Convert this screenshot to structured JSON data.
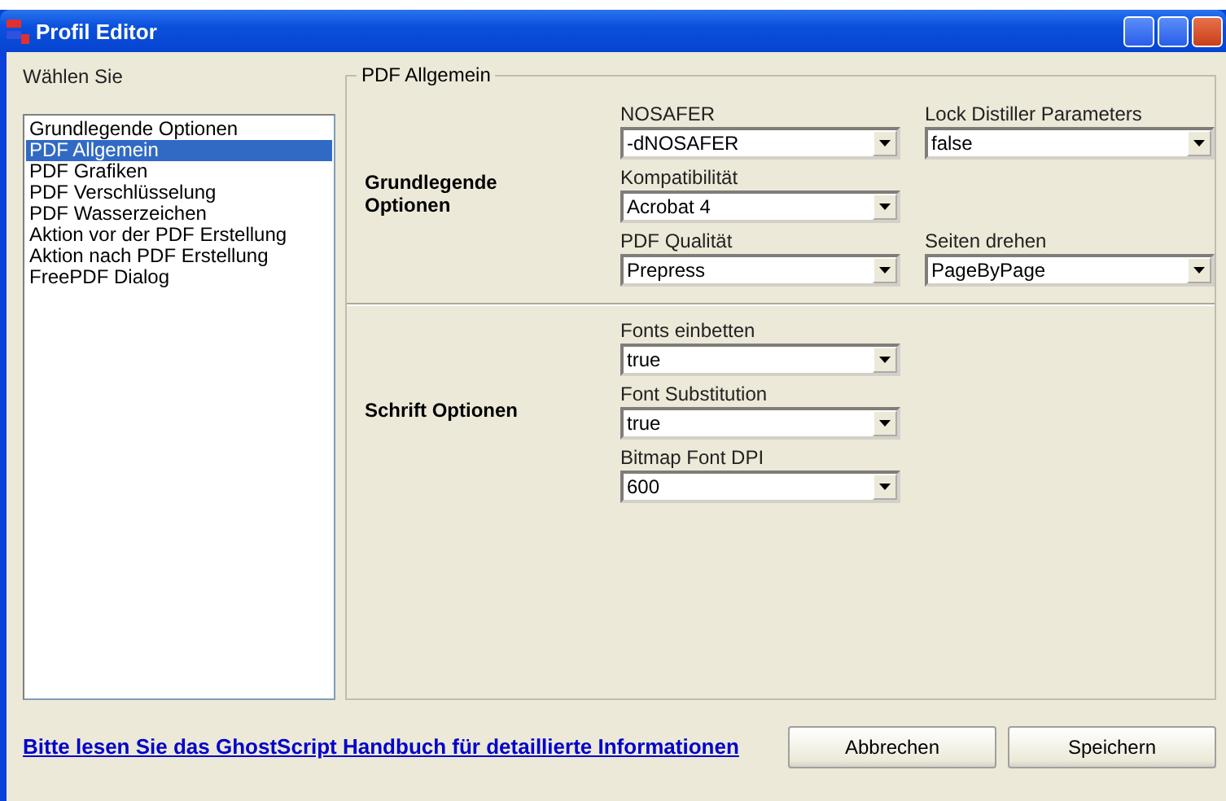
{
  "window": {
    "title": "Profil Editor"
  },
  "sidebar": {
    "label": "Wählen Sie",
    "items": [
      {
        "label": "Grundlegende Optionen",
        "selected": false
      },
      {
        "label": "PDF Allgemein",
        "selected": true
      },
      {
        "label": "PDF Grafiken",
        "selected": false
      },
      {
        "label": "PDF Verschlüsselung",
        "selected": false
      },
      {
        "label": "PDF Wasserzeichen",
        "selected": false
      },
      {
        "label": "Aktion vor der PDF Erstellung",
        "selected": false
      },
      {
        "label": "Aktion nach PDF Erstellung",
        "selected": false
      },
      {
        "label": "FreePDF Dialog",
        "selected": false
      }
    ]
  },
  "group": {
    "title": "PDF Allgemein",
    "sections": [
      {
        "title": "Grundlegende Optionen",
        "rows": [
          [
            {
              "label": "NOSAFER",
              "value": "-dNOSAFER"
            },
            {
              "label": "Lock Distiller Parameters",
              "value": "false"
            }
          ],
          [
            {
              "label": "Kompatibilität",
              "value": "Acrobat 4"
            }
          ],
          [
            {
              "label": "PDF Qualität",
              "value": "Prepress"
            },
            {
              "label": "Seiten drehen",
              "value": "PageByPage"
            }
          ]
        ]
      },
      {
        "title": "Schrift Optionen",
        "rows": [
          [
            {
              "label": "Fonts einbetten",
              "value": "true"
            }
          ],
          [
            {
              "label": "Font Substitution",
              "value": "true"
            }
          ],
          [
            {
              "label": "Bitmap Font DPI",
              "value": "600"
            }
          ]
        ]
      }
    ]
  },
  "help_link": "Bitte lesen Sie das GhostScript Handbuch für detaillierte Informationen",
  "buttons": [
    "Abbrechen",
    "Speichern"
  ]
}
